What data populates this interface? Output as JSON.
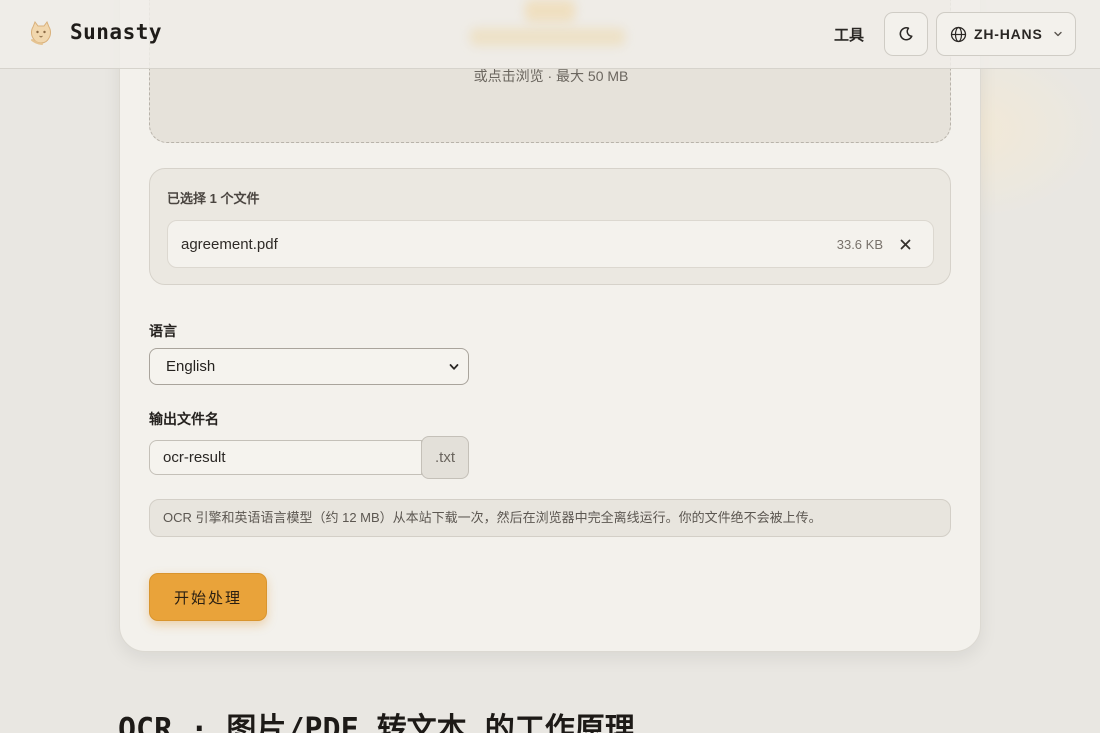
{
  "header": {
    "brand": "Sunasty",
    "nav_tools": "工具",
    "theme_icon": "moon-icon",
    "language_label": "ZH-HANS"
  },
  "dropzone": {
    "hint": "或点击浏览 · 最大 50 MB"
  },
  "files": {
    "title": "已选择 1 个文件",
    "items": [
      {
        "name": "agreement.pdf",
        "size": "33.6 KB"
      }
    ]
  },
  "language": {
    "label": "语言",
    "selected": "English"
  },
  "output": {
    "label": "输出文件名",
    "value": "ocr-result",
    "extension": ".txt"
  },
  "notice": "OCR 引擎和英语语言模型（约 12 MB）从本站下载一次，然后在浏览器中完全离线运行。你的文件绝不会被上传。",
  "start_button": "开始处理",
  "section_title": "OCR · 图片/PDF 转文本 的工作原理",
  "colors": {
    "accent": "#e9a33a",
    "background": "#e9e7e2",
    "card": "#f3f1ec"
  }
}
